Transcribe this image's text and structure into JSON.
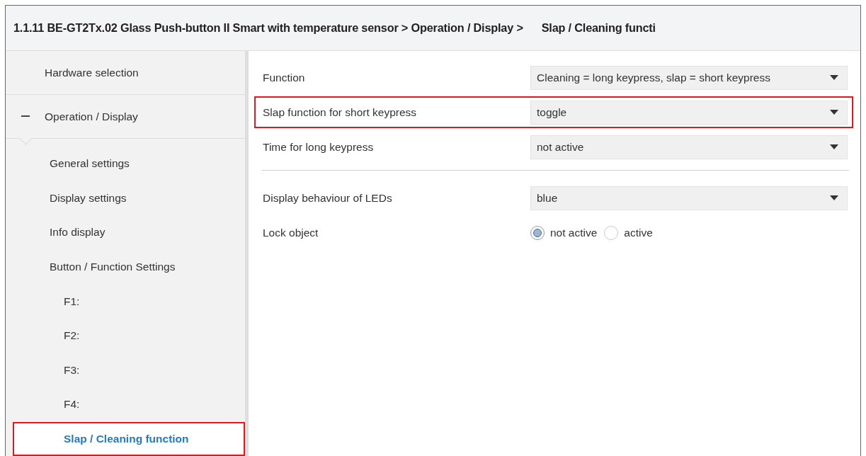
{
  "header": {
    "path": "1.1.11 BE-GT2Tx.02 Glass Push-button II Smart with temperature sensor > Operation / Display >",
    "current": "Slap / Cleaning functi"
  },
  "sidebar": {
    "items": [
      {
        "label": "Hardware selection",
        "selected": false
      },
      {
        "label": "Operation / Display",
        "selected": false,
        "expanded": true,
        "children": [
          {
            "label": "General settings",
            "selected": false
          },
          {
            "label": "Display settings",
            "selected": false
          },
          {
            "label": "Info display",
            "selected": false
          },
          {
            "label": "Button / Function Settings",
            "selected": false,
            "children": [
              {
                "label": "F1:",
                "selected": false
              },
              {
                "label": "F2:",
                "selected": false
              },
              {
                "label": "F3:",
                "selected": false
              },
              {
                "label": "F4:",
                "selected": false
              },
              {
                "label": "Slap / Cleaning function",
                "selected": true,
                "highlighted": true
              }
            ]
          }
        ]
      }
    ]
  },
  "parameters": [
    {
      "kind": "dropdown",
      "label": "Function",
      "value": "Cleaning = long keypress, slap = short keypress",
      "highlighted": false
    },
    {
      "kind": "dropdown",
      "label": "Slap function for short keypress",
      "value": "toggle",
      "highlighted": true
    },
    {
      "kind": "dropdown",
      "label": "Time for long keypress",
      "value": "not active",
      "highlighted": false
    },
    {
      "kind": "divider"
    },
    {
      "kind": "dropdown",
      "label": "Display behaviour of LEDs",
      "value": "blue",
      "highlighted": false
    },
    {
      "kind": "radio",
      "label": "Lock object",
      "options": [
        {
          "label": "not active",
          "selected": true
        },
        {
          "label": "active",
          "selected": false
        }
      ],
      "highlighted": false
    }
  ]
}
